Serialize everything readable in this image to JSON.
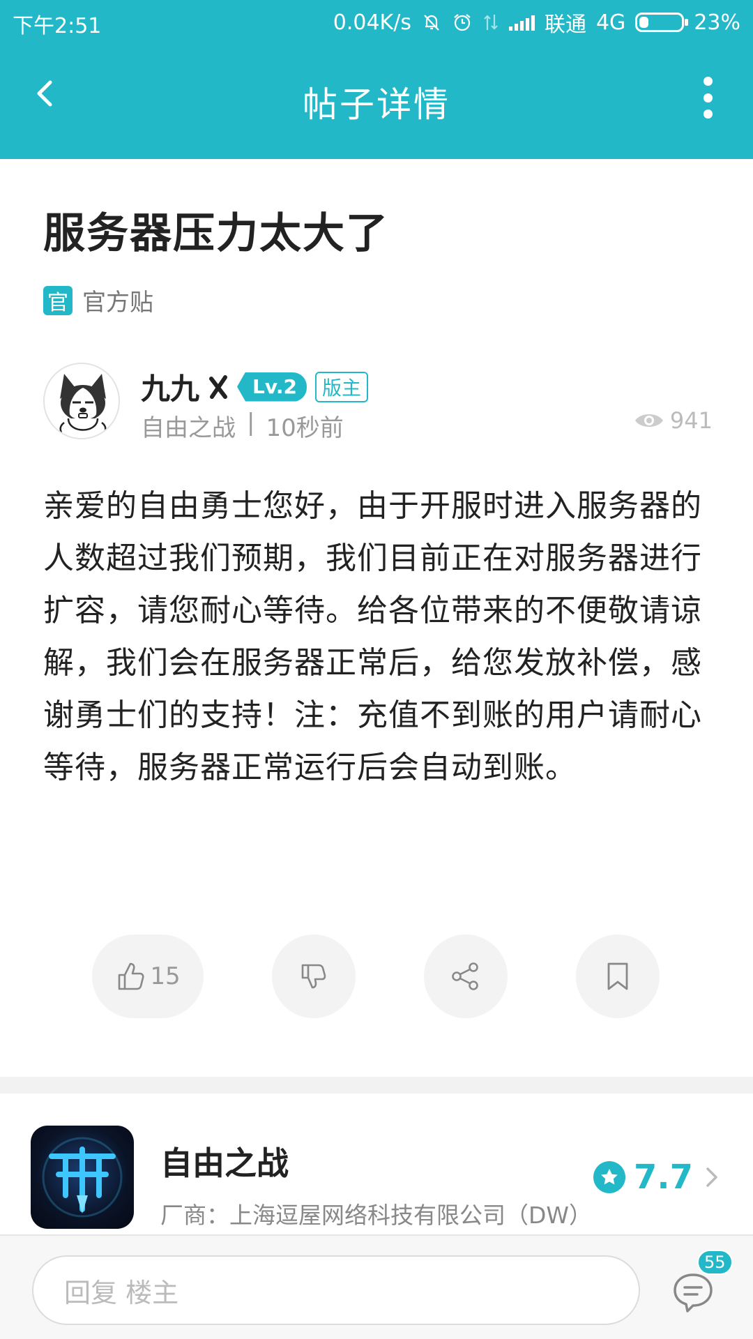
{
  "status_bar": {
    "time": "下午2:51",
    "net_speed": "0.04K/s",
    "carrier": "联通",
    "network": "4G",
    "battery": "23%",
    "battery_level": 0.23,
    "icons": [
      "mute-bell-icon",
      "alarm-icon",
      "data-arrows-icon",
      "signal-icon",
      "battery-icon"
    ]
  },
  "header": {
    "title": "帖子详情",
    "back_icon": "chevron-left-icon",
    "more_icon": "more-vertical-icon"
  },
  "post": {
    "title": "服务器压力太大了",
    "official_badge": "官",
    "official_label": "官方贴",
    "author": {
      "name": "九九",
      "level": "Lv.2",
      "role": "版主",
      "forum": "自由之战",
      "separator": "|",
      "time": "10秒前"
    },
    "views": "941",
    "body": "亲爱的自由勇士您好，由于开服时进入服务器的人数超过我们预期，我们目前正在对服务器进行扩容，请您耐心等待。给各位带来的不便敬请谅解，我们会在服务器正常后，给您发放补偿，感谢勇士们的支持！注：充值不到账的用户请耐心等待，服务器正常运行后会自动到账。"
  },
  "actions": {
    "like_count": "15",
    "icons": [
      "thumbs-up-icon",
      "thumbs-down-icon",
      "share-icon",
      "bookmark-icon"
    ]
  },
  "game": {
    "name": "自由之战",
    "vendor": "厂商：上海逗屋网络科技有限公司（DW）",
    "rating": "7.7"
  },
  "bottom": {
    "reply_placeholder": "回复  楼主",
    "comment_count": "55"
  },
  "colors": {
    "accent": "#22b8c8",
    "text": "#222222",
    "muted": "#999999"
  }
}
